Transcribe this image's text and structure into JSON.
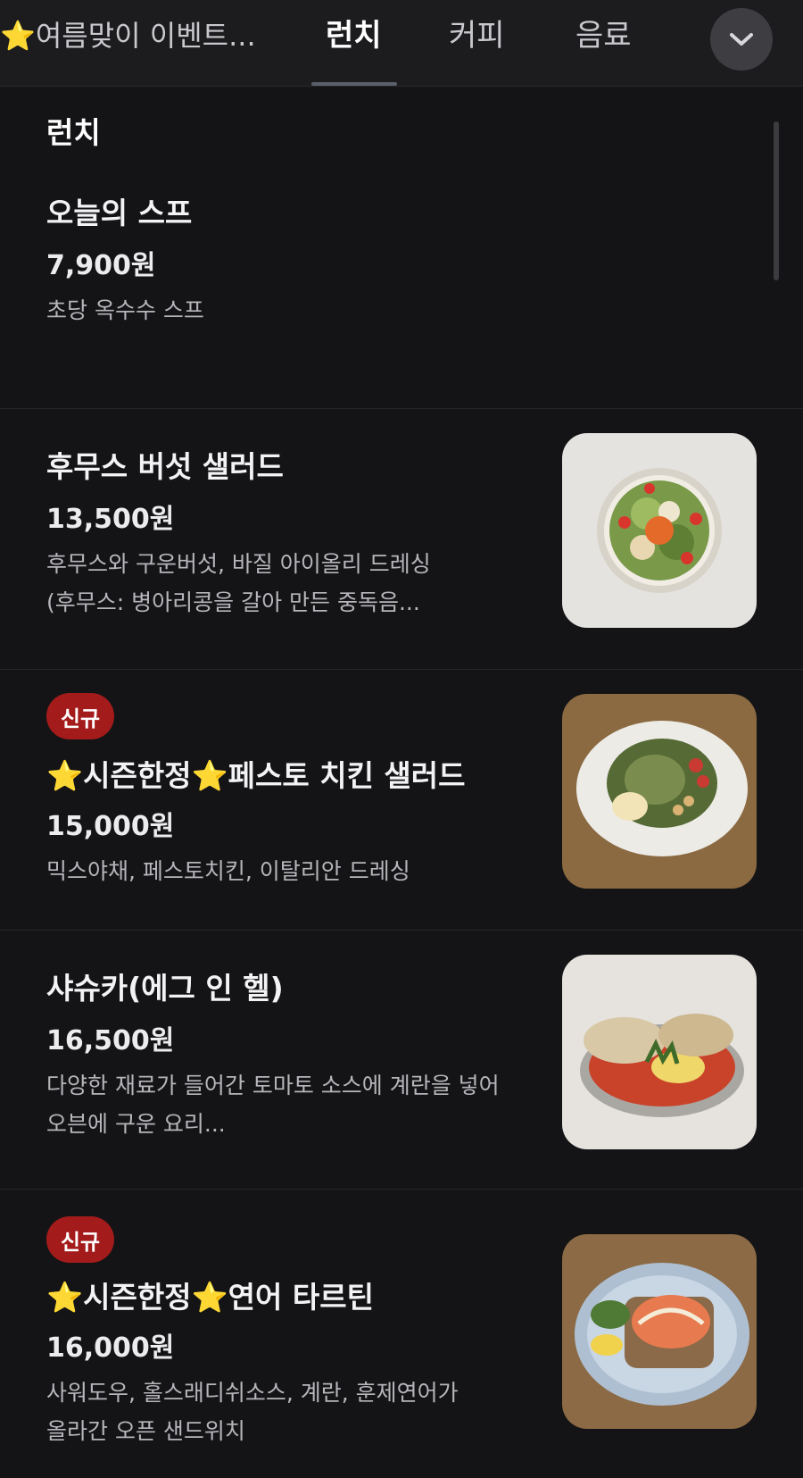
{
  "tabs": {
    "event_star": "⭐",
    "event_label": "여름맞이 이벤트...",
    "lunch": "런치",
    "coffee": "커피",
    "drink": "음료",
    "expand_icon": "chevron-down-icon"
  },
  "section": {
    "title": "런치"
  },
  "items": [
    {
      "name": "오늘의 스프",
      "price": "7,900원",
      "desc": "초당 옥수수 스프"
    },
    {
      "name": "후무스 버섯 샐러드",
      "price": "13,500원",
      "desc_line1": "후무스와 구운버섯, 바질 아이올리 드레싱",
      "desc_line2": "(후무스:  병아리콩을 갈아 만든 중독음..."
    },
    {
      "badge": "신규",
      "star": "⭐",
      "name_main": "시즌한정",
      "name_rest": "페스토 치킨 샐러드",
      "price": "15,000원",
      "desc": "믹스야채, 페스토치킨, 이탈리안 드레싱"
    },
    {
      "name": "샤슈카(에그 인 헬)",
      "price": "16,500원",
      "desc_line1": "다양한 재료가 들어간 토마토 소스에 계란을 넣어",
      "desc_line2": "오븐에 구운 요리..."
    },
    {
      "badge": "신규",
      "star": "⭐",
      "name_main": "시즌한정",
      "name_rest": "연어 타르틴",
      "price": "16,000원",
      "desc_line1": "사워도우, 홀스래디쉬소스, 계란, 훈제연어가",
      "desc_line2": "올라간 오픈 샌드위치"
    }
  ],
  "colors": {
    "background": "#141416",
    "badge": "#a41b1b",
    "star": "#f5c518"
  }
}
